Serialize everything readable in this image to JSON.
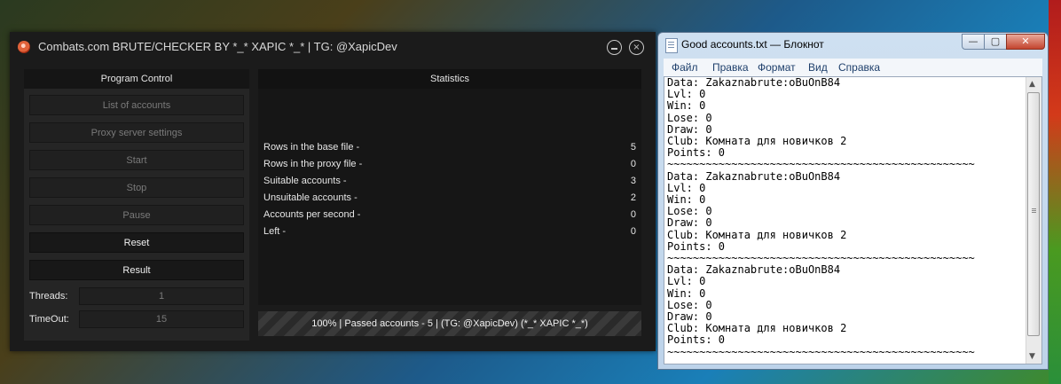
{
  "app": {
    "title": "Combats.com BRUTE/CHECKER BY *_* XAPIC *_* | TG: @XapicDev",
    "close_glyph": "×",
    "program_control": {
      "title": "Program Control",
      "buttons": [
        {
          "label": "List of accounts",
          "enabled": false
        },
        {
          "label": "Proxy server settings",
          "enabled": false
        },
        {
          "label": "Start",
          "enabled": false
        },
        {
          "label": "Stop",
          "enabled": false
        },
        {
          "label": "Pause",
          "enabled": false
        },
        {
          "label": "Reset",
          "enabled": true
        },
        {
          "label": "Result",
          "enabled": true
        }
      ],
      "threads_label": "Threads:",
      "threads_value": "1",
      "timeout_label": "TimeOut:",
      "timeout_value": "15"
    },
    "statistics": {
      "title": "Statistics",
      "rows": [
        {
          "label": "Rows in the base file -",
          "value": "5"
        },
        {
          "label": "Rows in the proxy file -",
          "value": "0"
        },
        {
          "label": "Suitable accounts -",
          "value": "3"
        },
        {
          "label": "Unsuitable accounts -",
          "value": "2"
        },
        {
          "label": "Accounts per second -",
          "value": "0"
        },
        {
          "label": "Left -",
          "value": "0"
        }
      ]
    },
    "progress": {
      "percent": 100,
      "text": "100% | Passed accounts - 5 | (TG: @XapicDev) (*_* XAPIC *_*)"
    }
  },
  "notepad": {
    "title": "Good accounts.txt — Блокнот",
    "controls": {
      "minimize": "—",
      "maximize": "▢",
      "close": "✕"
    },
    "menu": [
      "Файл",
      "Правка",
      "Формат",
      "Вид",
      "Справка"
    ],
    "lines": [
      "Data: Zakaznabrute:oBuOnB84",
      "Lvl: 0",
      "Win: 0",
      "Lose: 0",
      "Draw: 0",
      "Club: Комната для новичков 2",
      "Points: 0",
      "~~~~~~~~~~~~~~~~~~~~~~~~~~~~~~~~~~~~~~~~~~~~~~~~",
      "Data: Zakaznabrute:oBuOnB84",
      "Lvl: 0",
      "Win: 0",
      "Lose: 0",
      "Draw: 0",
      "Club: Комната для новичков 2",
      "Points: 0",
      "~~~~~~~~~~~~~~~~~~~~~~~~~~~~~~~~~~~~~~~~~~~~~~~~",
      "Data: Zakaznabrute:oBuOnB84",
      "Lvl: 0",
      "Win: 0",
      "Lose: 0",
      "Draw: 0",
      "Club: Комната для новичков 2",
      "Points: 0",
      "~~~~~~~~~~~~~~~~~~~~~~~~~~~~~~~~~~~~~~~~~~~~~~~~"
    ]
  }
}
